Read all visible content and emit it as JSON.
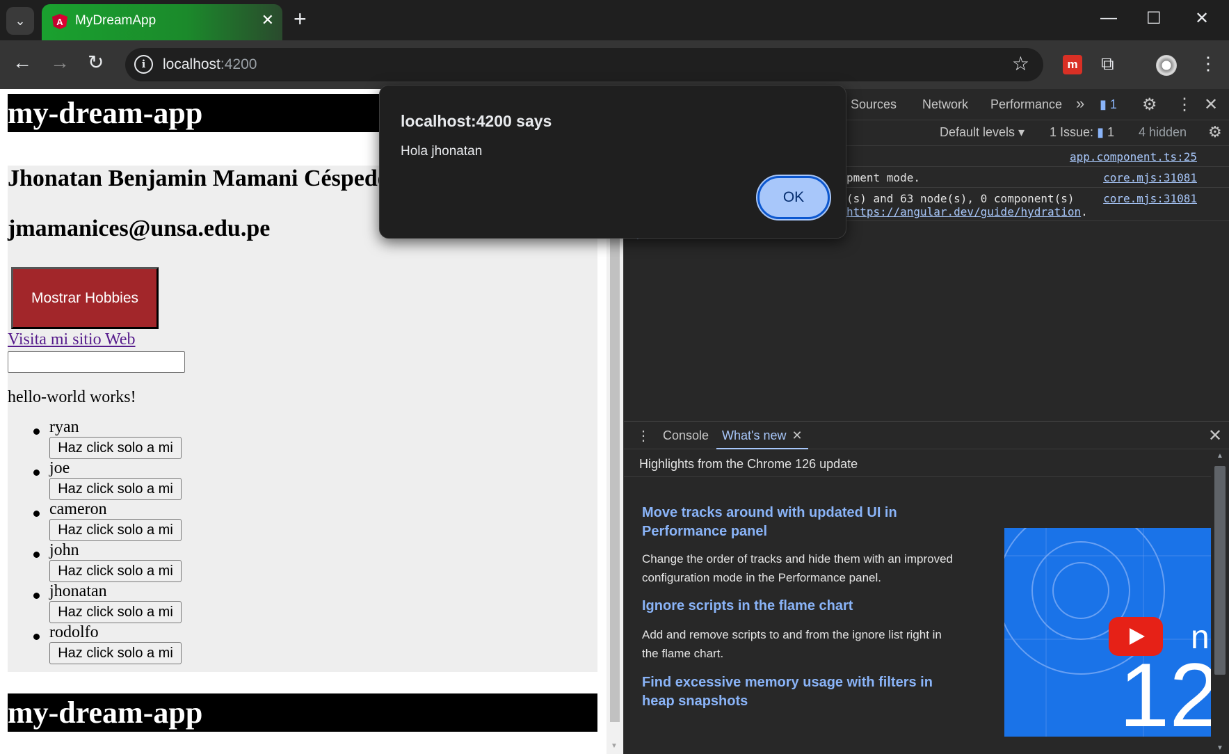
{
  "browser": {
    "tab_title": "MyDreamApp",
    "url_host": "localhost",
    "url_port": ":4200"
  },
  "page": {
    "header_title": "my-dream-app",
    "name": "Jhonatan Benjamin Mamani Céspedes",
    "email": "jmamanices@unsa.edu.pe",
    "hobbies_button": "Mostrar Hobbies",
    "web_link": "Visita mi sitio Web",
    "input_value": "",
    "hello_text": "hello-world works!",
    "users": [
      {
        "name": "ryan",
        "button": "Haz click solo a mi"
      },
      {
        "name": "joe",
        "button": "Haz click solo a mi"
      },
      {
        "name": "cameron",
        "button": "Haz click solo a mi"
      },
      {
        "name": "john",
        "button": "Haz click solo a mi"
      },
      {
        "name": "jhonatan",
        "button": "Haz click solo a mi"
      },
      {
        "name": "rodolfo",
        "button": "Haz click solo a mi"
      }
    ],
    "footer_title": "my-dream-app",
    "hobbies_button_color": "#a2262a"
  },
  "devtools": {
    "tabs": [
      "Sources",
      "Network",
      "Performance"
    ],
    "more_tabs": "»",
    "issue_badge": "1",
    "default_levels": "Default levels ▾",
    "issue_label": "1 Issue:",
    "issue_num": "1",
    "hidden": "4 hidden",
    "console": [
      {
        "message": "",
        "source": "app.component.ts:25"
      },
      {
        "message": "pment mode.",
        "source": "core.mjs:31081"
      },
      {
        "message": "(s) and 63 node(s), 0 component(s)",
        "link": "https://angular.dev/guide/hydration",
        "source": "core.mjs:31081"
      }
    ],
    "drawer": {
      "tab_console": "Console",
      "tab_whatsnew": "What's new",
      "title": "Highlights from the Chrome 126 update",
      "items": [
        {
          "heading": "Move tracks around with updated UI in Performance panel",
          "body": "Change the order of tracks and hide them with an improved configuration mode in the Performance panel."
        },
        {
          "heading": "Ignore scripts in the flame chart",
          "body": "Add and remove scripts to and from the ignore list right in the flame chart."
        },
        {
          "heading": "Find excessive memory usage with filters in heap snapshots",
          "body": ""
        }
      ],
      "thumb_number": "12",
      "thumb_letter": "n"
    }
  },
  "alert": {
    "title": "localhost:4200 says",
    "message": "Hola jhonatan",
    "ok": "OK"
  }
}
